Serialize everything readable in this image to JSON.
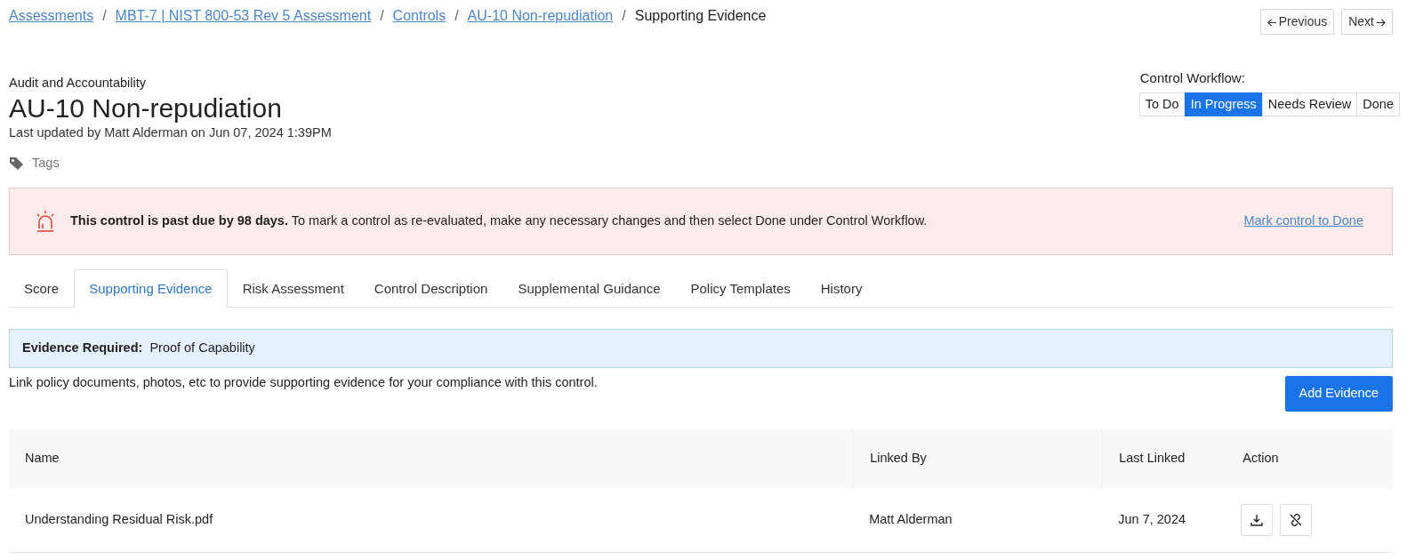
{
  "breadcrumbs": [
    {
      "label": "Assessments",
      "link": true
    },
    {
      "label": "MBT-7 | NIST 800-53 Rev 5 Assessment",
      "link": true
    },
    {
      "label": "Controls",
      "link": true
    },
    {
      "label": "AU-10 Non-repudiation",
      "link": true
    },
    {
      "label": "Supporting Evidence",
      "link": false
    }
  ],
  "breadcrumb_separators": [
    "/",
    "/",
    "/",
    "/"
  ],
  "pager": {
    "previous": "Previous",
    "next": "Next"
  },
  "header": {
    "family": "Audit and Accountability",
    "title": "AU-10 Non-repudiation",
    "updated": "Last updated by Matt Alderman on Jun 07, 2024 1:39PM",
    "tags": "Tags"
  },
  "workflow": {
    "label": "Control Workflow:",
    "steps": [
      {
        "label": "To Do",
        "selected": false
      },
      {
        "label": "In Progress",
        "selected": true
      },
      {
        "label": "Needs Review",
        "selected": false
      },
      {
        "label": "Done",
        "selected": false
      }
    ]
  },
  "alert": {
    "message": "**This control is past due by 98 days.** To mark a control as re-evaluated, make any necessary changes and then select Done under Control Workflow.",
    "link": "Mark control to Done"
  },
  "tabs": [
    {
      "label": "Score",
      "selected": false
    },
    {
      "label": "Supporting Evidence",
      "selected": true
    },
    {
      "label": "Risk Assessment",
      "selected": false
    },
    {
      "label": "Control Description",
      "selected": false
    },
    {
      "label": "Supplemental Guidance",
      "selected": false
    },
    {
      "label": "Policy Templates",
      "selected": false
    },
    {
      "label": "History",
      "selected": false
    }
  ],
  "evidence_required": {
    "label": "Evidence Required:",
    "value": "Proof of Capability"
  },
  "description": "Link policy documents, photos, etc to provide supporting evidence for your compliance with this control.",
  "add_button": "Add Evidence",
  "table": {
    "columns": [
      "Name",
      "Linked By",
      "Last Linked",
      "Action"
    ],
    "rows": [
      {
        "name": "Understanding Residual Risk.pdf",
        "linked_by": "Matt Alderman",
        "last_linked": "Jun 7, 2024"
      }
    ]
  }
}
